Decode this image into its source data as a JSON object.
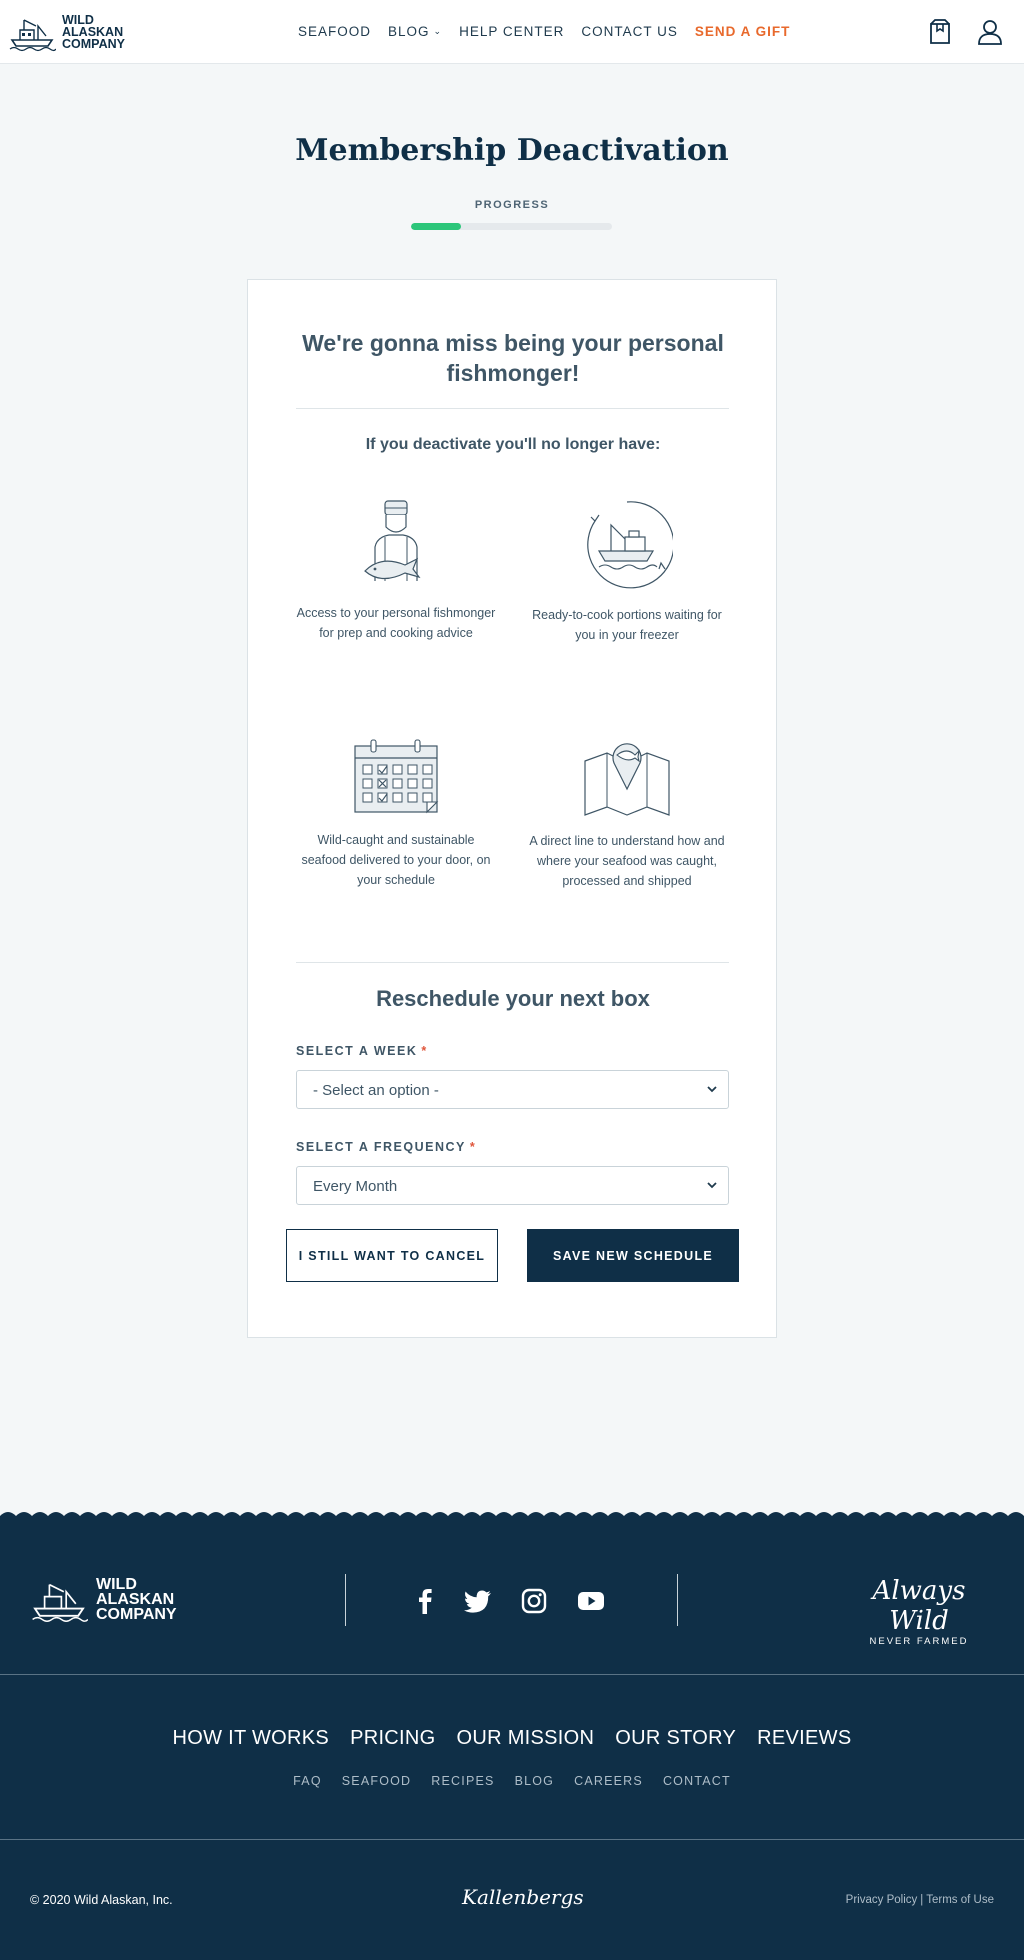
{
  "header": {
    "logo_lines": [
      "WILD",
      "ALASKAN",
      "COMPANY"
    ],
    "nav": [
      {
        "label": "SEAFOOD"
      },
      {
        "label": "BLOG"
      },
      {
        "label": "HELP CENTER"
      },
      {
        "label": "CONTACT US"
      },
      {
        "label": "SEND A GIFT",
        "accent": "#e8692c"
      }
    ]
  },
  "page": {
    "title": "Membership Deactivation",
    "progress_label": "PROGRESS",
    "progress_fraction": 0.25,
    "progress_color": "#2cc67a"
  },
  "card": {
    "heading": "We're gonna miss being your personal fishmonger!",
    "lose_heading": "If you deactivate you'll no longer have:",
    "benefits": [
      {
        "icon": "fishmonger-icon",
        "text": "Access to your personal fishmonger for prep and cooking advice"
      },
      {
        "icon": "fishing-boat-icon",
        "text": "Ready-to-cook portions waiting for you in your freezer"
      },
      {
        "icon": "calendar-icon",
        "text": "Wild-caught and sustainable seafood delivered to your door, on your schedule"
      },
      {
        "icon": "map-pin-icon",
        "text": "A direct line to understand how and where your seafood was caught, processed and shipped"
      }
    ],
    "reschedule_heading": "Reschedule your next box",
    "week_label": "SELECT A WEEK",
    "week_value": "- Select an option -",
    "frequency_label": "SELECT A FREQUENCY",
    "frequency_value": "Every Month",
    "required_mark": "*",
    "cancel_button": "I STILL WANT TO CANCEL",
    "save_button": "SAVE NEW SCHEDULE"
  },
  "footer": {
    "logo_lines": [
      "WILD",
      "ALASKAN",
      "COMPANY"
    ],
    "social": [
      "facebook-icon",
      "twitter-icon",
      "instagram-icon",
      "youtube-icon"
    ],
    "tagline_script": "Always Wild",
    "tagline_sub": "NEVER FARMED",
    "main_links": [
      "HOW IT WORKS",
      "PRICING",
      "OUR MISSION",
      "OUR STORY",
      "REVIEWS"
    ],
    "sub_links": [
      "FAQ",
      "SEAFOOD",
      "RECIPES",
      "BLOG",
      "CAREERS",
      "CONTACT"
    ],
    "copyright": "© 2020 Wild Alaskan, Inc.",
    "credit": "Kallenbergs",
    "privacy": "Privacy Policy",
    "separator": "|",
    "terms": "Terms of Use"
  }
}
